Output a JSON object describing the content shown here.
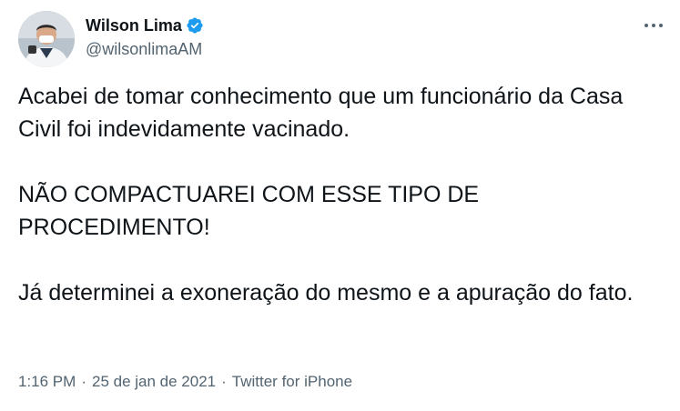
{
  "author": {
    "display_name": "Wilson Lima",
    "handle": "@wilsonlimaAM",
    "verified": true
  },
  "tweet": {
    "paragraphs": [
      "Acabei de tomar conhecimento que um funcionário da Casa Civil foi indevidamente vacinado.",
      "NÃO COMPACTUAREI COM ESSE TIPO DE PROCEDIMENTO!",
      "Já determinei a exoneração do mesmo e a apuração do fato."
    ]
  },
  "meta": {
    "time": "1:16 PM",
    "date": "25 de jan de 2021",
    "separator": "·",
    "source": "Twitter for iPhone"
  },
  "icons": {
    "verified": "verified-badge-icon",
    "more": "more-options-icon"
  },
  "colors": {
    "verified": "#1d9bf0",
    "text": "#0f1419",
    "secondary": "#536471"
  }
}
